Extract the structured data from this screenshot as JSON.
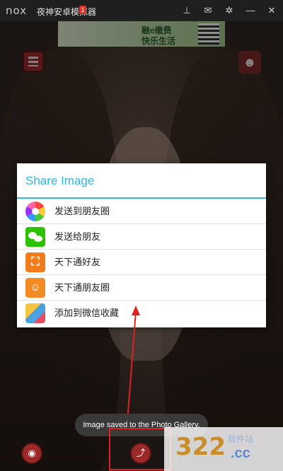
{
  "window": {
    "logo": "nox",
    "title": "夜神安卓模拟器",
    "badge": "1",
    "icons": [
      "pin-icon",
      "mail-icon",
      "settings-icon",
      "minimize-icon",
      "close-icon"
    ]
  },
  "ad": {
    "line1": "融e缴费",
    "line2": "快乐生活"
  },
  "dialog": {
    "title": "Share Image",
    "items": [
      {
        "label": "发送到朋友圈",
        "icon": "wechat-moments-icon"
      },
      {
        "label": "发送给朋友",
        "icon": "wechat-icon"
      },
      {
        "label": "天下通好友",
        "icon": "tianxiatong-friends-icon"
      },
      {
        "label": "天下通朋友圈",
        "icon": "tianxiatong-moments-icon"
      },
      {
        "label": "添加到微信收藏",
        "icon": "wechat-favorites-icon"
      }
    ]
  },
  "toast": "Image saved to the Photo Gallery.",
  "watermark": {
    "number": "322",
    "site": "软件站",
    "domain": ".cc"
  },
  "colors": {
    "accent": "#33b5e5",
    "buttons": "#9c2828"
  }
}
